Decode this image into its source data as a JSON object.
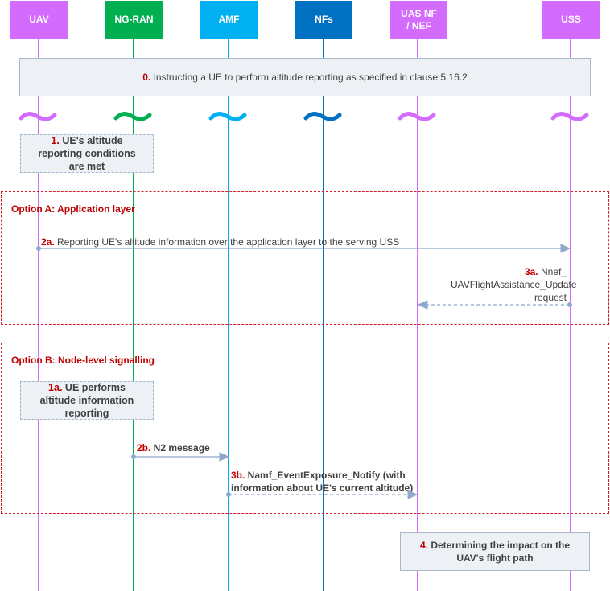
{
  "participants": [
    {
      "id": "uav",
      "label": "UAV",
      "color": "#d36bff"
    },
    {
      "id": "ngran",
      "label": "NG-RAN",
      "color": "#00b050"
    },
    {
      "id": "amf",
      "label": "AMF",
      "color": "#00b0f0"
    },
    {
      "id": "nfs",
      "label": "NFs",
      "color": "#0070c0"
    },
    {
      "id": "uasnf",
      "label": "UAS NF\n/ NEF",
      "color": "#d36bff"
    },
    {
      "id": "uss",
      "label": "USS",
      "color": "#d36bff"
    }
  ],
  "steps": {
    "step0": {
      "num": "0.",
      "text": " Instructing a UE to perform altitude reporting as specified in clause 5.16.2"
    },
    "step1": {
      "num": "1.",
      "text": " UE's altitude reporting conditions are met"
    },
    "step2a": {
      "num": "2a.",
      "text": " Reporting UE's altitude information over the application layer to the serving USS"
    },
    "step3a": {
      "num": "3a.",
      "text": " Nnef_ UAVFlightAssistance_Update request"
    },
    "step1a": {
      "num": "1a.",
      "text": " UE performs altitude information reporting"
    },
    "step2b": {
      "num": "2b.",
      "text": " N2 message"
    },
    "step3b": {
      "num": "3b.",
      "text": " Namf_EventExposure_Notify (with information about UE's current altitude)"
    },
    "step4": {
      "num": "4.",
      "text": " Determining the impact on the UAV's flight path"
    }
  },
  "options": {
    "a": {
      "title": "Option A: Application layer"
    },
    "b": {
      "title": "Option B: Node-level signalling"
    }
  },
  "colors": {
    "step_number": "#c00000",
    "option_border": "#d0202a",
    "arrow": "#8fa8cc",
    "note_fill": "#edf0f5"
  }
}
